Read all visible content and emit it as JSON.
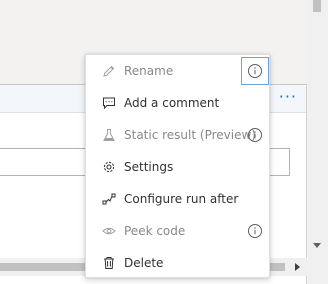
{
  "background_panel": {
    "more_label": "···"
  },
  "context_menu": {
    "items": [
      {
        "label": "Rename",
        "icon": "pencil-icon",
        "enabled": false,
        "has_info": true
      },
      {
        "label": "Add a comment",
        "icon": "comment-icon",
        "enabled": true,
        "has_info": false
      },
      {
        "label": "Static result (Preview)",
        "icon": "flask-icon",
        "enabled": false,
        "has_info": true
      },
      {
        "label": "Settings",
        "icon": "gear-icon",
        "enabled": true,
        "has_info": false
      },
      {
        "label": "Configure run after",
        "icon": "run-after-icon",
        "enabled": true,
        "has_info": false
      },
      {
        "label": "Peek code",
        "icon": "eye-icon",
        "enabled": false,
        "has_info": true
      },
      {
        "label": "Delete",
        "icon": "trash-icon",
        "enabled": true,
        "has_info": false
      }
    ]
  },
  "colors": {
    "accent": "#0078d4",
    "text_enabled": "#323130",
    "text_disabled": "#8a8886",
    "icon_enabled": "#323130",
    "icon_disabled": "#a19f9d",
    "menu_background": "#ffffff",
    "page_background": "#f3f2f1"
  }
}
